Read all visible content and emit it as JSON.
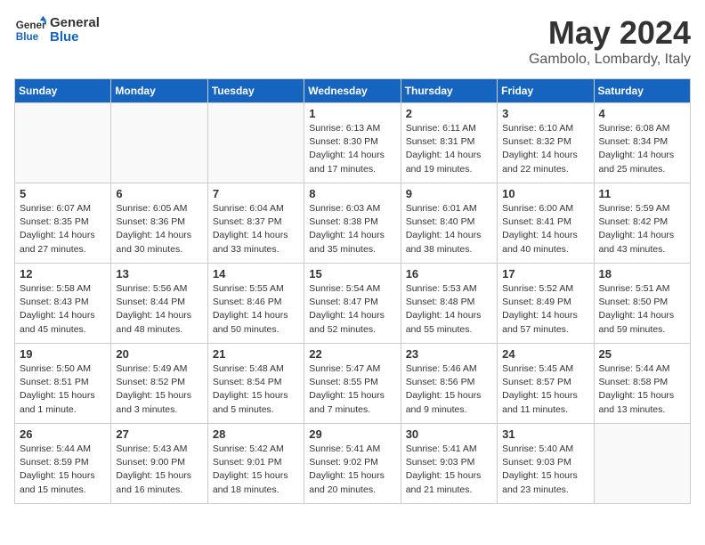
{
  "header": {
    "logo_line1": "General",
    "logo_line2": "Blue",
    "month": "May 2024",
    "location": "Gambolo, Lombardy, Italy"
  },
  "weekdays": [
    "Sunday",
    "Monday",
    "Tuesday",
    "Wednesday",
    "Thursday",
    "Friday",
    "Saturday"
  ],
  "weeks": [
    [
      {
        "day": "",
        "info": ""
      },
      {
        "day": "",
        "info": ""
      },
      {
        "day": "",
        "info": ""
      },
      {
        "day": "1",
        "info": "Sunrise: 6:13 AM\nSunset: 8:30 PM\nDaylight: 14 hours\nand 17 minutes."
      },
      {
        "day": "2",
        "info": "Sunrise: 6:11 AM\nSunset: 8:31 PM\nDaylight: 14 hours\nand 19 minutes."
      },
      {
        "day": "3",
        "info": "Sunrise: 6:10 AM\nSunset: 8:32 PM\nDaylight: 14 hours\nand 22 minutes."
      },
      {
        "day": "4",
        "info": "Sunrise: 6:08 AM\nSunset: 8:34 PM\nDaylight: 14 hours\nand 25 minutes."
      }
    ],
    [
      {
        "day": "5",
        "info": "Sunrise: 6:07 AM\nSunset: 8:35 PM\nDaylight: 14 hours\nand 27 minutes."
      },
      {
        "day": "6",
        "info": "Sunrise: 6:05 AM\nSunset: 8:36 PM\nDaylight: 14 hours\nand 30 minutes."
      },
      {
        "day": "7",
        "info": "Sunrise: 6:04 AM\nSunset: 8:37 PM\nDaylight: 14 hours\nand 33 minutes."
      },
      {
        "day": "8",
        "info": "Sunrise: 6:03 AM\nSunset: 8:38 PM\nDaylight: 14 hours\nand 35 minutes."
      },
      {
        "day": "9",
        "info": "Sunrise: 6:01 AM\nSunset: 8:40 PM\nDaylight: 14 hours\nand 38 minutes."
      },
      {
        "day": "10",
        "info": "Sunrise: 6:00 AM\nSunset: 8:41 PM\nDaylight: 14 hours\nand 40 minutes."
      },
      {
        "day": "11",
        "info": "Sunrise: 5:59 AM\nSunset: 8:42 PM\nDaylight: 14 hours\nand 43 minutes."
      }
    ],
    [
      {
        "day": "12",
        "info": "Sunrise: 5:58 AM\nSunset: 8:43 PM\nDaylight: 14 hours\nand 45 minutes."
      },
      {
        "day": "13",
        "info": "Sunrise: 5:56 AM\nSunset: 8:44 PM\nDaylight: 14 hours\nand 48 minutes."
      },
      {
        "day": "14",
        "info": "Sunrise: 5:55 AM\nSunset: 8:46 PM\nDaylight: 14 hours\nand 50 minutes."
      },
      {
        "day": "15",
        "info": "Sunrise: 5:54 AM\nSunset: 8:47 PM\nDaylight: 14 hours\nand 52 minutes."
      },
      {
        "day": "16",
        "info": "Sunrise: 5:53 AM\nSunset: 8:48 PM\nDaylight: 14 hours\nand 55 minutes."
      },
      {
        "day": "17",
        "info": "Sunrise: 5:52 AM\nSunset: 8:49 PM\nDaylight: 14 hours\nand 57 minutes."
      },
      {
        "day": "18",
        "info": "Sunrise: 5:51 AM\nSunset: 8:50 PM\nDaylight: 14 hours\nand 59 minutes."
      }
    ],
    [
      {
        "day": "19",
        "info": "Sunrise: 5:50 AM\nSunset: 8:51 PM\nDaylight: 15 hours\nand 1 minute."
      },
      {
        "day": "20",
        "info": "Sunrise: 5:49 AM\nSunset: 8:52 PM\nDaylight: 15 hours\nand 3 minutes."
      },
      {
        "day": "21",
        "info": "Sunrise: 5:48 AM\nSunset: 8:54 PM\nDaylight: 15 hours\nand 5 minutes."
      },
      {
        "day": "22",
        "info": "Sunrise: 5:47 AM\nSunset: 8:55 PM\nDaylight: 15 hours\nand 7 minutes."
      },
      {
        "day": "23",
        "info": "Sunrise: 5:46 AM\nSunset: 8:56 PM\nDaylight: 15 hours\nand 9 minutes."
      },
      {
        "day": "24",
        "info": "Sunrise: 5:45 AM\nSunset: 8:57 PM\nDaylight: 15 hours\nand 11 minutes."
      },
      {
        "day": "25",
        "info": "Sunrise: 5:44 AM\nSunset: 8:58 PM\nDaylight: 15 hours\nand 13 minutes."
      }
    ],
    [
      {
        "day": "26",
        "info": "Sunrise: 5:44 AM\nSunset: 8:59 PM\nDaylight: 15 hours\nand 15 minutes."
      },
      {
        "day": "27",
        "info": "Sunrise: 5:43 AM\nSunset: 9:00 PM\nDaylight: 15 hours\nand 16 minutes."
      },
      {
        "day": "28",
        "info": "Sunrise: 5:42 AM\nSunset: 9:01 PM\nDaylight: 15 hours\nand 18 minutes."
      },
      {
        "day": "29",
        "info": "Sunrise: 5:41 AM\nSunset: 9:02 PM\nDaylight: 15 hours\nand 20 minutes."
      },
      {
        "day": "30",
        "info": "Sunrise: 5:41 AM\nSunset: 9:03 PM\nDaylight: 15 hours\nand 21 minutes."
      },
      {
        "day": "31",
        "info": "Sunrise: 5:40 AM\nSunset: 9:03 PM\nDaylight: 15 hours\nand 23 minutes."
      },
      {
        "day": "",
        "info": ""
      }
    ]
  ]
}
